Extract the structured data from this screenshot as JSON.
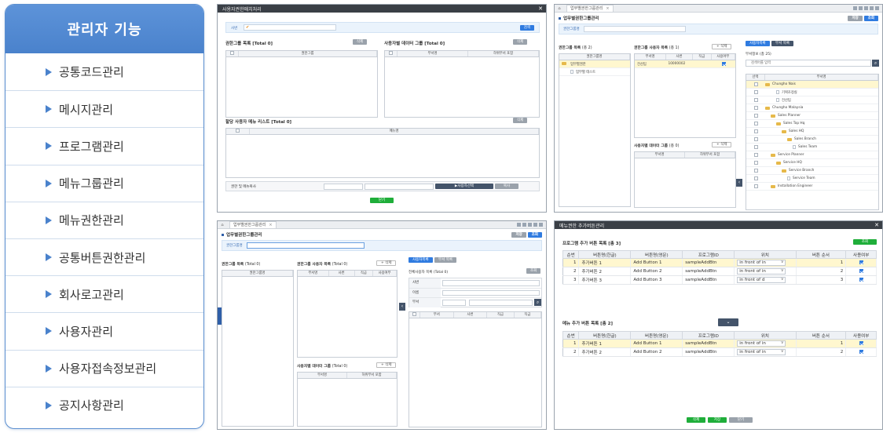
{
  "menu": {
    "title": "관리자 기능",
    "items": [
      "공통코드관리",
      "메시지관리",
      "프로그램관리",
      "메뉴그룹관리",
      "메뉴권한관리",
      "공통버튼권한관리",
      "회사로고관리",
      "사용자관리",
      "사용자접속정보관리",
      "공지사항관리"
    ],
    "accent": "#4a82cc"
  },
  "p1": {
    "title": "사용자권한매치처리",
    "search_label": "사번",
    "search_button": "검색",
    "group_list": "권한그룹 목록",
    "group_total": "[Total 0]",
    "group_btn": "삭제",
    "group_col": "권한그룹",
    "user_data_group": "사용자별 데이터 그룹",
    "user_data_total": "[Total 0]",
    "user_data_btn": "삭제",
    "col_empno": "부서명",
    "col_sub": "하위부서 포함",
    "assigned_menu": "할당 사용자 메뉴 리스트",
    "assigned_total": "[Total 0]",
    "assigned_btn": "삭제",
    "menu_col": "메뉴명",
    "copy_label": "권한 및 메뉴복사",
    "copy_btn": "▶사용자선택",
    "copy_btn2": "복사",
    "close_btn": "닫기"
  },
  "p2": {
    "tab": "업무별권한그룹관리",
    "title": "업무별권한그룹관리",
    "btn1": "저장",
    "btn2": "조회",
    "strip": "권한그룹명",
    "group_list": "권한그룹 목록",
    "group_total": "(총 2)",
    "group_col": "권한그룹명",
    "groups": [
      "업무별권한",
      "업무별 테스트"
    ],
    "users": "권한그룹 사용자 목록",
    "users_total": "(총 1)",
    "users_btn": "+ 삭제",
    "cols": [
      "부서명",
      "사번",
      "직급",
      "사용여부"
    ],
    "row": [
      "전산팀",
      "10000002"
    ],
    "tab_a": "사용자목록",
    "tab_b": "부서 목록",
    "dept_label": "부서정보",
    "dept_total": "(총 25)",
    "dept_search": "검색어를 입력",
    "data_group": "사용자별 데이터 그룹",
    "data_total": "(총 0)",
    "data_btn": "+ 삭제",
    "data_cols": [
      "부서명",
      "하위부서 포함"
    ],
    "tree_head": [
      "선택",
      "부서명"
    ],
    "tree": [
      "Chungho Nais",
      "기획조정실",
      "전산팀",
      "Chungho Malaysia",
      "Sales Planner",
      "Sales Top Hq",
      "Sales HQ",
      "Sales Branch",
      "Sales Team",
      "Service Planner",
      "Service HQ",
      "Service Branch",
      "Service Team",
      "Installation Engineer"
    ]
  },
  "p3": {
    "tab": "업무별권한그룹관리",
    "title": "업무별권한그룹관리",
    "btn1": "저장",
    "btn2": "조회",
    "strip": "권한그룹명",
    "group_list": "권한그룹 목록",
    "group_total": "(Total 0)",
    "group_col": "권한그룹명",
    "users": "권한그룹 사용자 목록",
    "users_total": "(Total 0)",
    "users_btn": "+ 삭제",
    "cols": [
      "부서명",
      "사번",
      "직급",
      "사용여부"
    ],
    "tab_a": "사용자목록",
    "tab_b": "부서 목록",
    "search_title": "전체사용자 목록",
    "search_total": "(Total 0)",
    "search_btn": "조회",
    "f1": "사번",
    "f2": "이름",
    "f3": "부서",
    "result_cols": [
      "부서",
      "사번",
      "직급",
      "직급"
    ],
    "data_group": "사용자별 데이터 그룹",
    "data_total": "(Total 0)",
    "data_btn": "+ 삭제",
    "data_cols": [
      "부서명",
      "하위부서 포함"
    ]
  },
  "p4": {
    "title": "메뉴권한 추가버튼관리",
    "prog_label": "프로그램 추가 버튼 목록",
    "prog_total": "[총 3]",
    "search_btn": "조회",
    "headers": [
      "순번",
      "버튼명(한글)",
      "버튼명(영문)",
      "프로그램ID",
      "위치",
      "버튼 순서",
      "사용여부"
    ],
    "prog_rows": [
      [
        "1",
        "추가버튼 1",
        "Add Button 1",
        "sampleAddBtn",
        "in front of in",
        "1"
      ],
      [
        "2",
        "추가버튼 2",
        "Add Button 2",
        "sampleAddBtn",
        "in front of in",
        "2"
      ],
      [
        "3",
        "추가버튼 3",
        "Add Button 3",
        "sampleAddBtn",
        "in front of d",
        "3"
      ]
    ],
    "menu_label": "메뉴 추가 버튼 목록",
    "menu_total": "[총 2]",
    "menu_rows": [
      [
        "1",
        "추가버튼 1",
        "Add Button 1",
        "sampleAddBtn",
        "in front of in",
        "1"
      ],
      [
        "2",
        "추가버튼 2",
        "Add Button 2",
        "sampleAddBtn",
        "in front of in",
        "2"
      ]
    ],
    "btn_delete": "삭제",
    "btn_save": "저장",
    "btn_close": "닫기"
  }
}
